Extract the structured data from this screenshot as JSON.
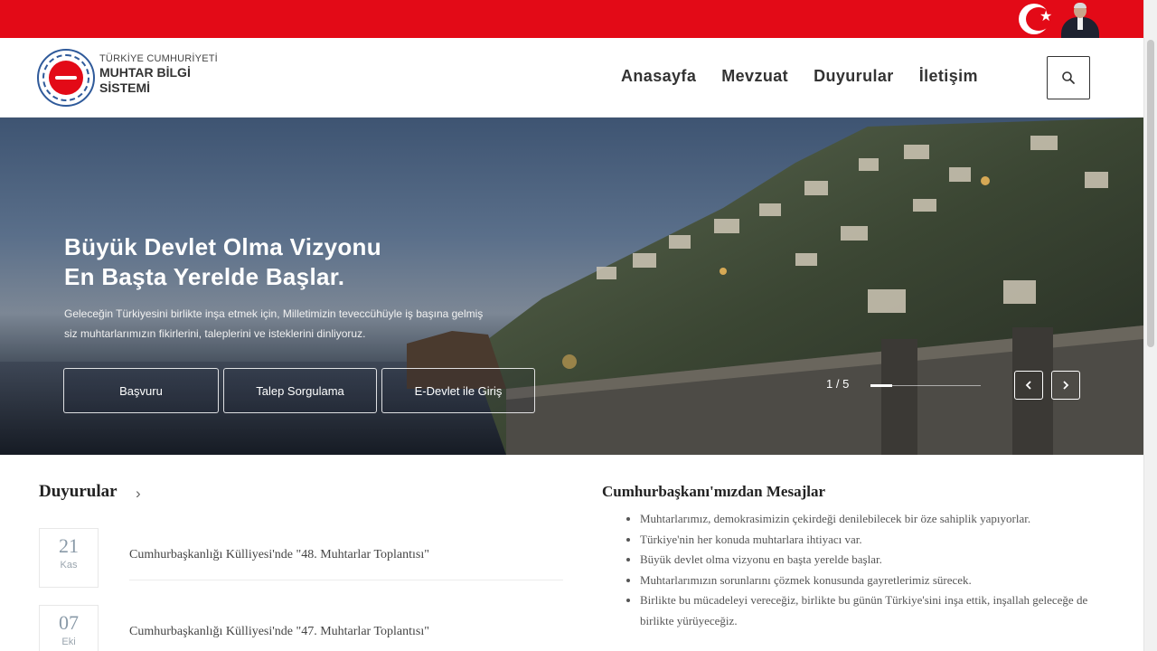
{
  "nav": {
    "items": [
      "Anasayfa",
      "Mevzuat",
      "Duyurular",
      "İletişim"
    ]
  },
  "logo": {
    "line1": "TÜRKİYE CUMHURİYETİ",
    "line2": "MUHTAR BİLGİ",
    "line3": "SİSTEMİ"
  },
  "hero": {
    "title_line1": "Büyük Devlet Olma Vizyonu",
    "title_line2": "En Başta Yerelde Başlar.",
    "text_line1": "Geleceğin Türkiyesini birlikte inşa etmek için, Milletimizin teveccühüyle iş başına gelmiş",
    "text_line2": "siz muhtarlarımızın fikirlerini, taleplerini ve isteklerini dinliyoruz.",
    "buttons": [
      "Başvuru",
      "Talep Sorgulama",
      "E-Devlet ile Giriş"
    ],
    "pager": "1 / 5"
  },
  "announcements": {
    "title": "Duyurular",
    "items": [
      {
        "day": "21",
        "month": "Kas",
        "text": "Cumhurbaşkanlığı Külliyesi'nde \"48. Muhtarlar Toplantısı\""
      },
      {
        "day": "07",
        "month": "Eki",
        "text": "Cumhurbaşkanlığı Külliyesi'nde \"47. Muhtarlar Toplantısı\""
      }
    ]
  },
  "messages": {
    "title": "Cumhurbaşkanı'mızdan Mesajlar",
    "items": [
      "Muhtarlarımız, demokrasimizin çekirdeği denilebilecek bir öze sahiplik yapıyorlar.",
      "Türkiye'nin her konuda muhtarlara ihtiyacı var.",
      "Büyük devlet olma vizyonu en başta yerelde başlar.",
      "Muhtarlarımızın sorunlarını çözmek konusunda gayretlerimiz sürecek.",
      "Birlikte bu mücadeleyi vereceğiz, birlikte bu günün Türkiye'sini inşa ettik, inşallah geleceğe de birlikte yürüyeceğiz."
    ]
  },
  "colors": {
    "brand_red": "#e30a17",
    "logo_blue": "#2f5a9a"
  },
  "icons": {
    "search": "search-icon",
    "prev": "chevron-left-icon",
    "next": "chevron-right-icon",
    "more": "chevron-right-icon"
  }
}
